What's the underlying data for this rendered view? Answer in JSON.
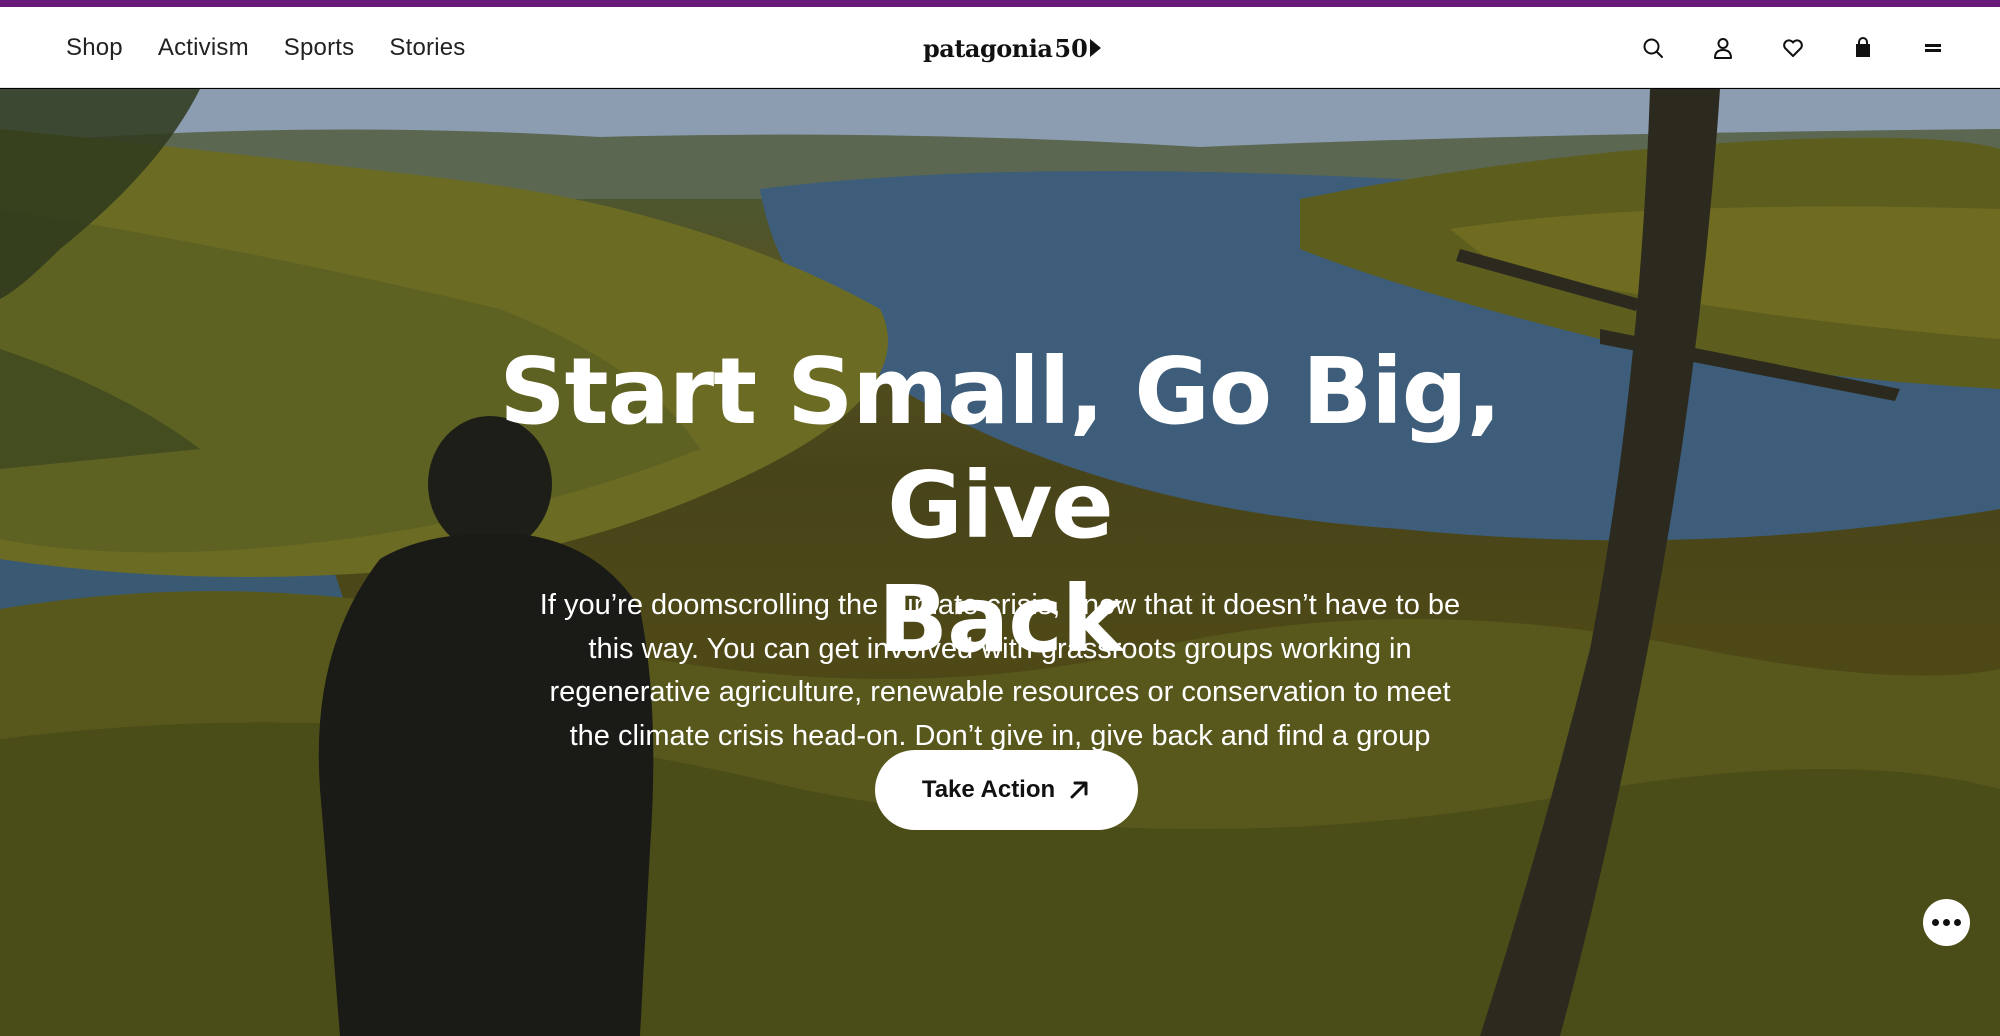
{
  "nav": {
    "links": [
      "Shop",
      "Activism",
      "Sports",
      "Stories"
    ],
    "logo_word": "patagonia",
    "logo_anniversary": "50",
    "icons": [
      "search-icon",
      "account-icon",
      "wishlist-heart-icon",
      "shopping-bag-icon",
      "menu-icon"
    ]
  },
  "hero": {
    "title_line1": "Start Small, Go Big, Give",
    "title_line2": "Back",
    "body": "If you’re doomscrolling the climate crisis, know that it doesn’t have to be this way. You can get involved with grassroots groups working in regenerative agriculture, renewable resources or conservation to meet the climate crisis head-on. Don’t give in, give back and find a group today.",
    "cta_label": "Take Action"
  },
  "colors": {
    "accent_bar": "#6a1b7a",
    "nav_bg": "#ffffff",
    "text_dark": "#222222",
    "hero_text": "#ffffff"
  }
}
